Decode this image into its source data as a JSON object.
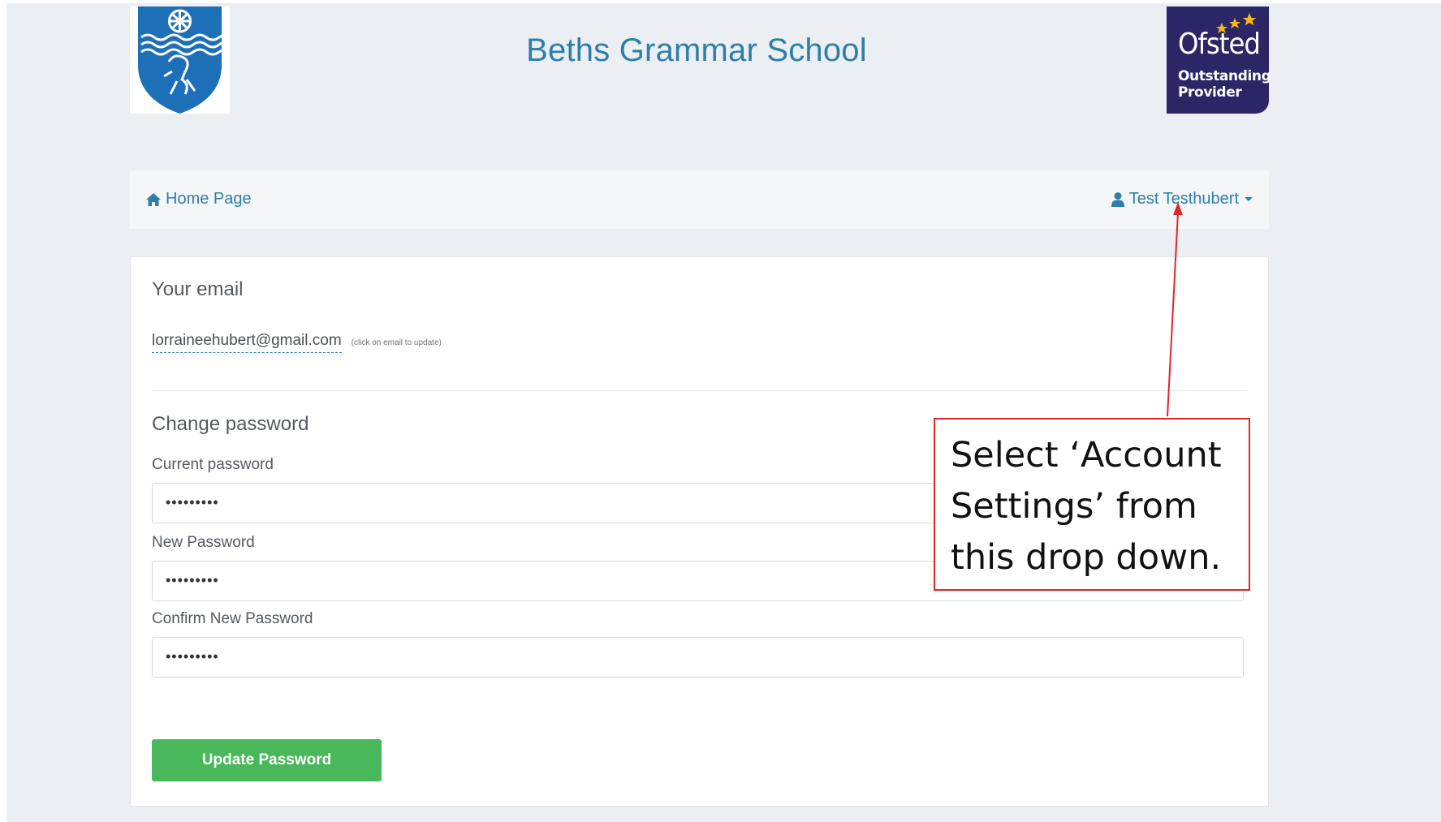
{
  "header": {
    "school_name": "Beths Grammar School",
    "crest_icon": "school-crest-icon",
    "ofsted": {
      "name": "Ofsted",
      "line1": "Outstanding",
      "line2": "Provider",
      "background": "#2b2766",
      "star_color": "#f2b81d"
    }
  },
  "navbar": {
    "home_label": "Home Page",
    "home_icon": "home-icon",
    "user_label": "Test Testhubert",
    "user_icon": "user-icon",
    "dropdown_icon": "caret-down-icon"
  },
  "email_section": {
    "title": "Your email",
    "email": "lorraineehubert@gmail.com",
    "hint": "(click on email to update)"
  },
  "password_section": {
    "title": "Change password",
    "current_label": "Current password",
    "current_value": "•••••••••",
    "new_label": "New Password",
    "new_value": "•••••••••",
    "confirm_label": "Confirm New Password",
    "confirm_value": "•••••••••",
    "submit_label": "Update Password"
  },
  "annotation": {
    "line1": "Select ‘Account",
    "line2": "Settings’ from",
    "line3": "this drop down.",
    "border_color": "#e0262b"
  },
  "colors": {
    "link": "#2d7fa8",
    "button": "#48b85a",
    "page_bg": "#ebeef2"
  }
}
